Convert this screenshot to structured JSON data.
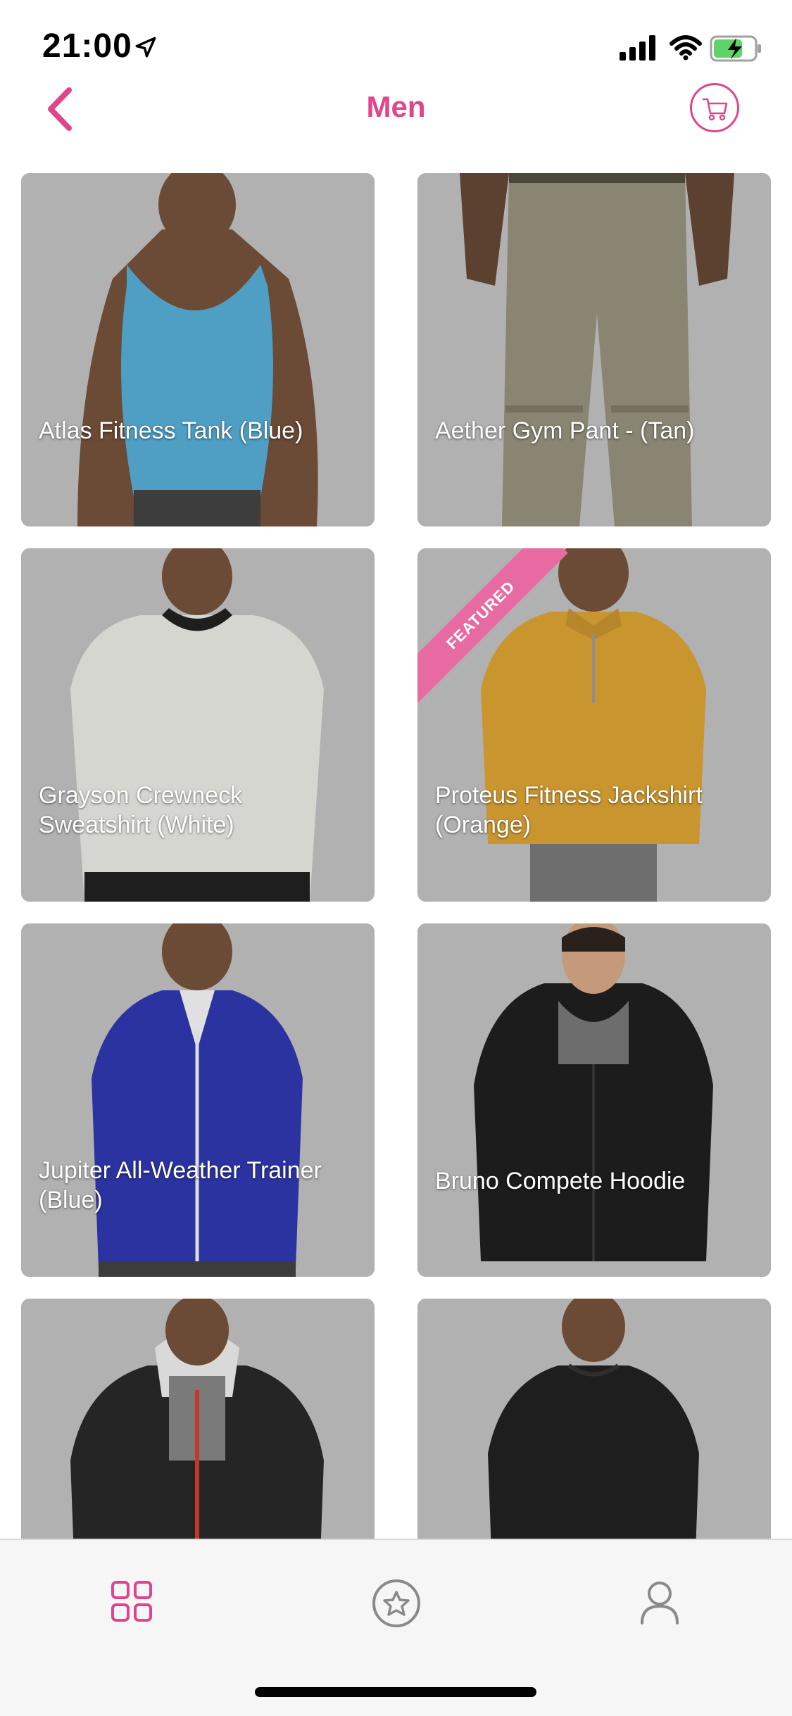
{
  "status": {
    "time": "21:00"
  },
  "nav": {
    "title": "Men"
  },
  "products": [
    {
      "name": "Atlas Fitness Tank (Blue)",
      "featured": false
    },
    {
      "name": "Aether Gym Pant - (Tan)",
      "featured": false
    },
    {
      "name": "Grayson Crewneck Sweatshirt (White)",
      "featured": false
    },
    {
      "name": "Proteus Fitness Jackshirt (Orange)",
      "featured": true
    },
    {
      "name": "Jupiter All-Weather Trainer (Blue)",
      "featured": false
    },
    {
      "name": "Bruno Compete Hoodie",
      "featured": false
    },
    {
      "name": "",
      "featured": false
    },
    {
      "name": "",
      "featured": false
    }
  ],
  "ribbon": {
    "label": "FEATURED"
  },
  "colors": {
    "accent": "#e0458b",
    "card_bg": "#b1b1b1"
  },
  "tabs": [
    {
      "icon": "grid-icon",
      "active": true
    },
    {
      "icon": "star-icon",
      "active": false
    },
    {
      "icon": "user-icon",
      "active": false
    }
  ]
}
